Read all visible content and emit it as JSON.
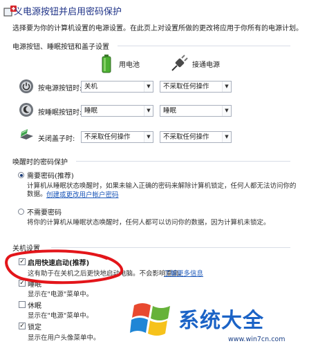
{
  "header": {
    "title": "义电源按钮并启用密码保护",
    "description": "选择要为你的计算机设置的电源设置。在此页上对设置所做的更改将应用于你所有的电源计划。"
  },
  "buttons_section": {
    "heading": "电源按钮、睡眠按钮和盖子设置",
    "columns": {
      "battery": "用电池",
      "plugged": "接通电源"
    },
    "rows": [
      {
        "label": "按电源按钮时:",
        "battery": "关机",
        "plugged": "不采取任何操作"
      },
      {
        "label": "按睡眠按钮时:",
        "battery": "睡眠",
        "plugged": "睡眠"
      },
      {
        "label": "关闭盖子时:",
        "battery": "不采取任何操作",
        "plugged": "不采取任何操作"
      }
    ]
  },
  "password_section": {
    "heading": "唤醒时的密码保护",
    "require": {
      "label": "需要密码(推荐)",
      "desc_line1": "计算机从睡眠状态唤醒时，如果未输入正确的密码来解除计算机锁定，任何人都无法访问你的",
      "desc_line2": "数据。",
      "link": "创建或更改用户帐户密码"
    },
    "no_require": {
      "label": "不需要密码",
      "desc": "将你的计算机从睡眠状态唤醒时，任何人都可以访问你的数据，因为计算机未锁定。"
    }
  },
  "shutdown_section": {
    "heading": "关机设置",
    "fast_startup": {
      "label": "启用快速启动(推荐)",
      "desc": "这有助于在关机之后更快地启动电脑。不会影响重启。",
      "link": "了解更多信息"
    },
    "sleep": {
      "label": "睡眠",
      "desc": "显示在\"电源\"菜单中。"
    },
    "hibernate": {
      "label": "休眠",
      "desc": "显示在\"电源\"菜单中。"
    },
    "lock": {
      "label": "锁定",
      "desc": "显示在用户头像菜单中。"
    }
  },
  "watermark": {
    "brand": "系统大全",
    "url": "www.win7cn.com"
  },
  "colors": {
    "title_blue": "#1e3287",
    "link_blue": "#1a56b8",
    "annotation_red": "#e3151a"
  }
}
